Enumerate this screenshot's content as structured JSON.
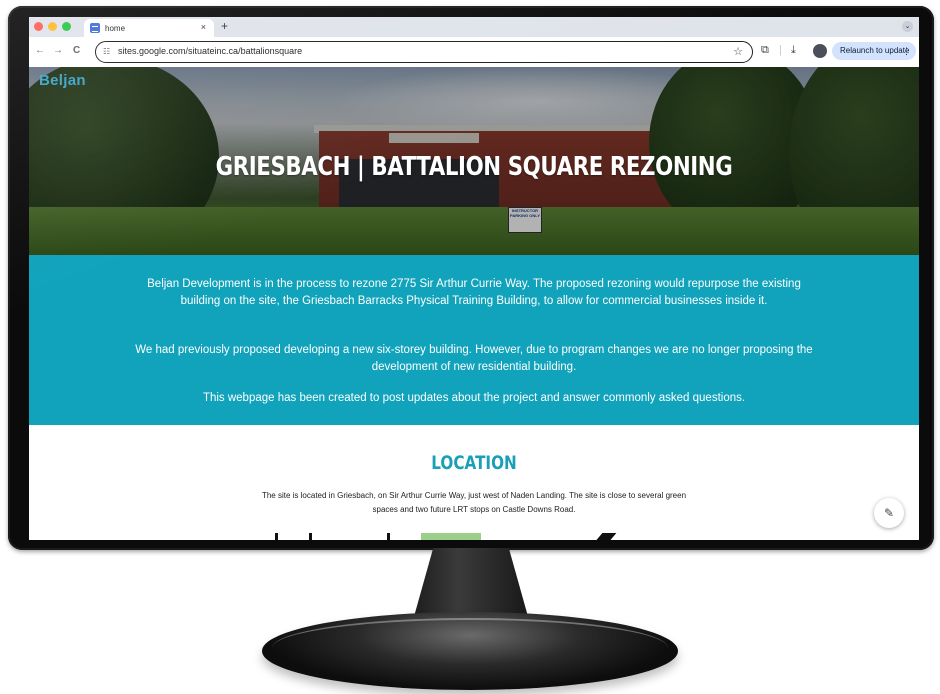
{
  "browser": {
    "tab_title": "home",
    "tab_close": "×",
    "new_tab": "+",
    "tab_menu": "⌄",
    "back": "←",
    "forward": "→",
    "reload": "C",
    "url": "sites.google.com/situateinc.ca/battalionsquare",
    "relaunch_label": "Relaunch to update",
    "relaunch_menu": "⋮",
    "colors": {
      "close": "#ff5f57",
      "minimize": "#febc2e",
      "maximize": "#28c840",
      "relaunch_bg": "#d3e3fd"
    }
  },
  "site": {
    "brand": "Beljan",
    "hero_title": "GRIESBACH | BATTALION SQUARE REZONING",
    "hero_sign": "INSTRUCTOR PARKING ONLY",
    "intro": {
      "p1": "Beljan Development is in the process to rezone 2775 Sir Arthur Currie Way. The proposed rezoning would repurpose the existing building on the site, the Griesbach Barracks Physical Training Building, to allow for commercial businesses inside it.",
      "p2": "We had previously proposed developing a new six-storey building. However, due to program changes we are no longer proposing the development of new residential building.",
      "p3": "This webpage has been created to post updates about the project and answer commonly asked questions."
    },
    "location": {
      "title": "LOCATION",
      "text": "The site is located in Griesbach, on Sir Arthur Currie Way, just west of Naden Landing. The site is close to several green spaces and two future LRT stops on Castle Downs Road."
    },
    "fab_icon": "✎",
    "colors": {
      "accent": "#10a3bb",
      "heading": "#1b9fb7",
      "brand": "#3aa4c6"
    }
  }
}
